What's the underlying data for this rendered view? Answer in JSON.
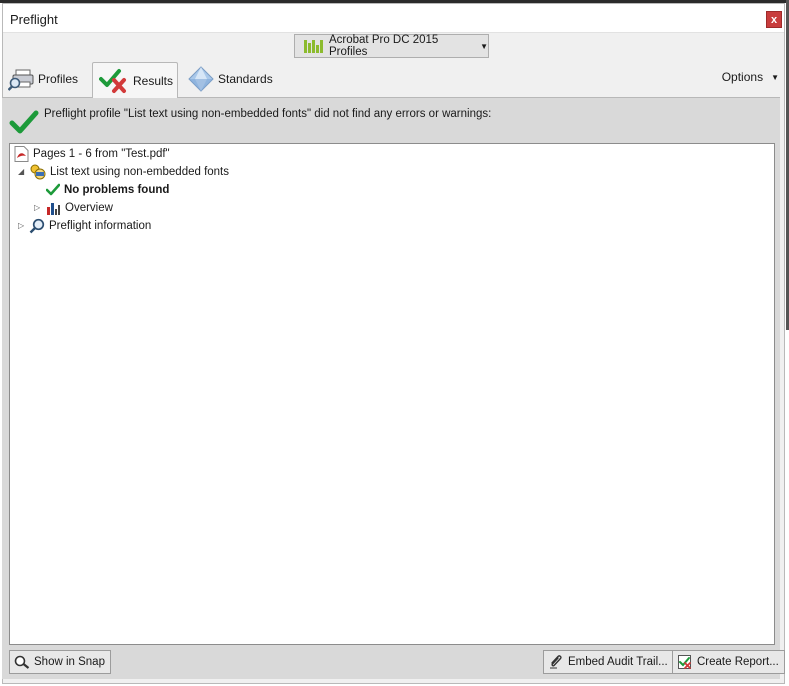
{
  "window": {
    "title": "Preflight",
    "close_label": "x"
  },
  "profiles_dropdown": {
    "label": "Acrobat Pro DC 2015 Profiles",
    "icon": "bar-chart-icon"
  },
  "tabs": [
    {
      "label": "Profiles",
      "icon": "profiles-search-icon",
      "selected": false
    },
    {
      "label": "Results",
      "icon": "results-check-cross-icon",
      "selected": true
    },
    {
      "label": "Standards",
      "icon": "diamond-icon",
      "selected": false
    }
  ],
  "options_label": "Options",
  "result_message": "Preflight profile \"List text using non-embedded fonts\" did not find any errors or warnings:",
  "tree": {
    "root": "Pages 1 - 6 from \"Test.pdf\"",
    "profile": "List text using non-embedded fonts",
    "status": "No problems found",
    "overview": "Overview",
    "info": "Preflight information"
  },
  "buttons": {
    "show_in_snap": "Show in Snap",
    "embed_audit_trail": "Embed Audit Trail...",
    "create_report": "Create Report..."
  },
  "colors": {
    "check_green": "#1d9a3a",
    "cross_red": "#d23a3a",
    "pdf_red": "#c62828"
  }
}
